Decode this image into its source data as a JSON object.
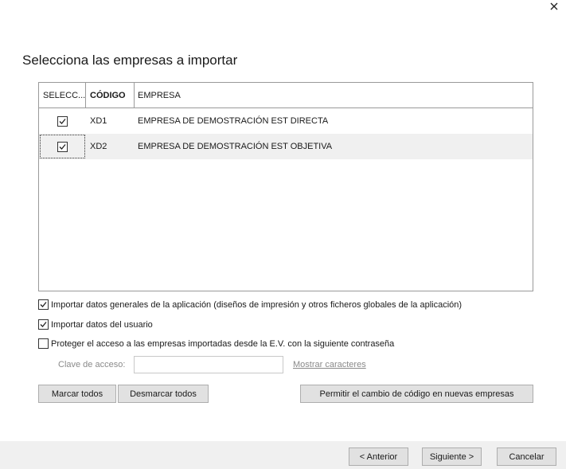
{
  "title": "Selecciona las empresas a importar",
  "grid": {
    "headers": {
      "select": "SELECC...",
      "code": "CÓDIGO",
      "company": "EMPRESA"
    },
    "rows": [
      {
        "checked": true,
        "code": "XD1",
        "company": "EMPRESA DE DEMOSTRACIÓN EST DIRECTA"
      },
      {
        "checked": true,
        "code": "XD2",
        "company": "EMPRESA DE DEMOSTRACIÓN EST OBJETIVA"
      }
    ]
  },
  "options": {
    "general": {
      "checked": true,
      "label": "Importar datos generales de la aplicación (diseños de impresión y otros ficheros globales de la aplicación)"
    },
    "user": {
      "checked": true,
      "label": "Importar datos del usuario"
    },
    "protect": {
      "checked": false,
      "label": "Proteger el acceso a las empresas importadas desde la E.V. con la siguiente contraseña"
    }
  },
  "password": {
    "label": "Clave de acceso:",
    "value": "",
    "show_chars_label": "Mostrar caracteres"
  },
  "buttons": {
    "mark_all": "Marcar todos",
    "unmark_all": "Desmarcar todos",
    "allow_code_change": "Permitir el cambio de código en nuevas empresas"
  },
  "footer": {
    "previous": "< Anterior",
    "next": "Siguiente >",
    "cancel": "Cancelar"
  },
  "icons": {
    "close": "close-icon",
    "check": "checkmark-icon"
  }
}
